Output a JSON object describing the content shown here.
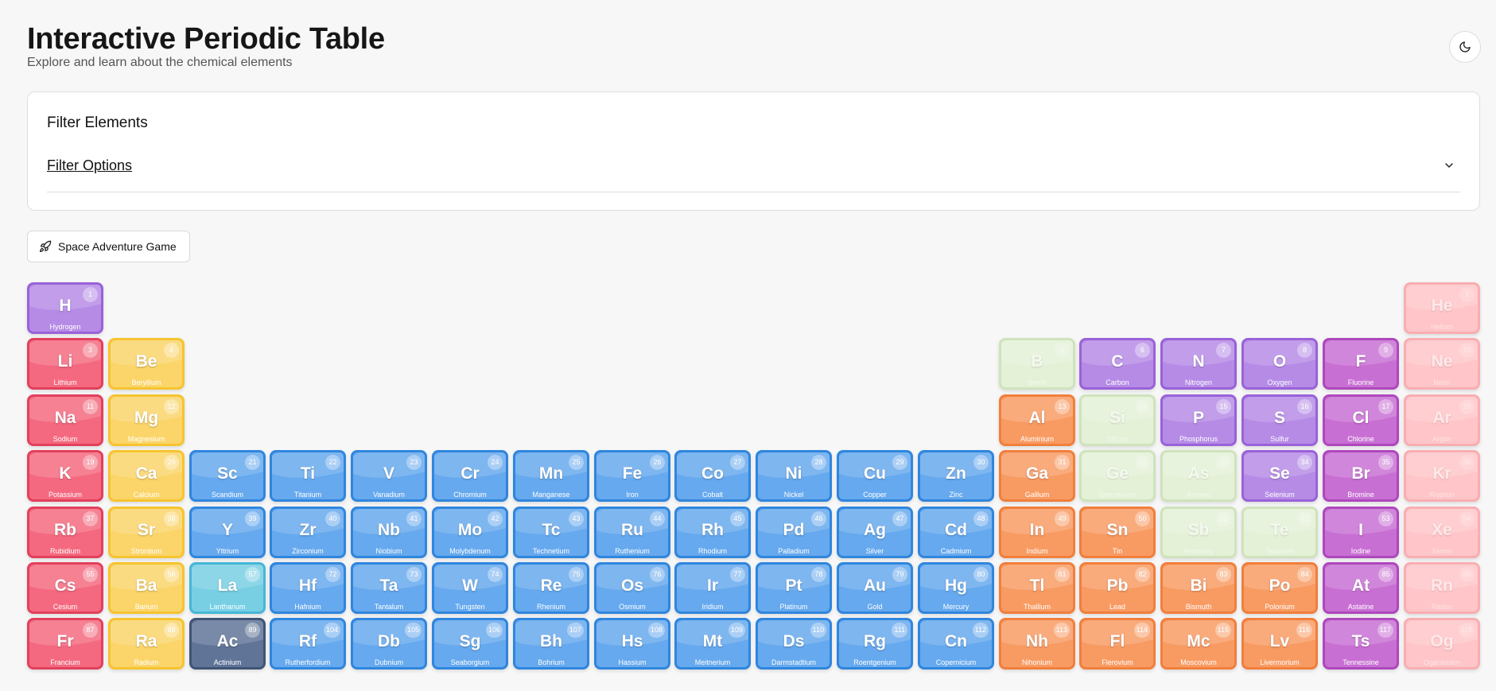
{
  "header": {
    "title": "Interactive Periodic Table",
    "subtitle": "Explore and learn about the chemical elements"
  },
  "theme_toggle": {
    "icon": "moon-icon"
  },
  "filter": {
    "title": "Filter Elements",
    "options_label": "Filter Options",
    "expand_icon": "chevron-down-icon"
  },
  "game_button": {
    "label": "Space Adventure Game",
    "icon": "rocket-icon"
  },
  "categories": {
    "nonmetal": {
      "fill": "#b68be6",
      "border": "#9a62d8"
    },
    "alkali": {
      "fill": "#f4697f",
      "border": "#e2405c"
    },
    "alkaline": {
      "fill": "#fbd56a",
      "border": "#f6c42f"
    },
    "transition": {
      "fill": "#66a9ee",
      "border": "#2f86de"
    },
    "lanthanide": {
      "fill": "#78cfe4",
      "border": "#46b7d6"
    },
    "actinide": {
      "fill": "#5f7497",
      "border": "#3f5476"
    },
    "metalloid": {
      "fill": "#e4f1d7",
      "border": "#cfe3bc"
    },
    "post_transition": {
      "fill": "#f89b63",
      "border": "#f17f3c"
    },
    "halogen": {
      "fill": "#c86fd3",
      "border": "#ae48bc"
    },
    "noble": {
      "fill": "#ffc5c8",
      "border": "#f9aeb2"
    }
  },
  "elements": [
    {
      "n": "1",
      "s": "H",
      "name": "Hydrogen",
      "c": "nonmetal",
      "r": 1,
      "g": 1
    },
    {
      "n": "2",
      "s": "He",
      "name": "Helium",
      "c": "noble",
      "r": 1,
      "g": 18
    },
    {
      "n": "3",
      "s": "Li",
      "name": "Lithium",
      "c": "alkali",
      "r": 2,
      "g": 1
    },
    {
      "n": "4",
      "s": "Be",
      "name": "Beryllium",
      "c": "alkaline",
      "r": 2,
      "g": 2
    },
    {
      "n": "5",
      "s": "B",
      "name": "Boron",
      "c": "metalloid",
      "r": 2,
      "g": 13
    },
    {
      "n": "6",
      "s": "C",
      "name": "Carbon",
      "c": "nonmetal",
      "r": 2,
      "g": 14
    },
    {
      "n": "7",
      "s": "N",
      "name": "Nitrogen",
      "c": "nonmetal",
      "r": 2,
      "g": 15
    },
    {
      "n": "8",
      "s": "O",
      "name": "Oxygen",
      "c": "nonmetal",
      "r": 2,
      "g": 16
    },
    {
      "n": "9",
      "s": "F",
      "name": "Fluorine",
      "c": "halogen",
      "r": 2,
      "g": 17
    },
    {
      "n": "10",
      "s": "Ne",
      "name": "Neon",
      "c": "noble",
      "r": 2,
      "g": 18
    },
    {
      "n": "11",
      "s": "Na",
      "name": "Sodium",
      "c": "alkali",
      "r": 3,
      "g": 1
    },
    {
      "n": "12",
      "s": "Mg",
      "name": "Magnesium",
      "c": "alkaline",
      "r": 3,
      "g": 2
    },
    {
      "n": "13",
      "s": "Al",
      "name": "Aluminium",
      "c": "post_transition",
      "r": 3,
      "g": 13
    },
    {
      "n": "14",
      "s": "Si",
      "name": "Silicon",
      "c": "metalloid",
      "r": 3,
      "g": 14
    },
    {
      "n": "15",
      "s": "P",
      "name": "Phosphorus",
      "c": "nonmetal",
      "r": 3,
      "g": 15
    },
    {
      "n": "16",
      "s": "S",
      "name": "Sulfur",
      "c": "nonmetal",
      "r": 3,
      "g": 16
    },
    {
      "n": "17",
      "s": "Cl",
      "name": "Chlorine",
      "c": "halogen",
      "r": 3,
      "g": 17
    },
    {
      "n": "18",
      "s": "Ar",
      "name": "Argon",
      "c": "noble",
      "r": 3,
      "g": 18
    },
    {
      "n": "19",
      "s": "K",
      "name": "Potassium",
      "c": "alkali",
      "r": 4,
      "g": 1
    },
    {
      "n": "20",
      "s": "Ca",
      "name": "Calcium",
      "c": "alkaline",
      "r": 4,
      "g": 2
    },
    {
      "n": "21",
      "s": "Sc",
      "name": "Scandium",
      "c": "transition",
      "r": 4,
      "g": 3
    },
    {
      "n": "22",
      "s": "Ti",
      "name": "Titanium",
      "c": "transition",
      "r": 4,
      "g": 4
    },
    {
      "n": "23",
      "s": "V",
      "name": "Vanadium",
      "c": "transition",
      "r": 4,
      "g": 5
    },
    {
      "n": "24",
      "s": "Cr",
      "name": "Chromium",
      "c": "transition",
      "r": 4,
      "g": 6
    },
    {
      "n": "25",
      "s": "Mn",
      "name": "Manganese",
      "c": "transition",
      "r": 4,
      "g": 7
    },
    {
      "n": "26",
      "s": "Fe",
      "name": "Iron",
      "c": "transition",
      "r": 4,
      "g": 8
    },
    {
      "n": "27",
      "s": "Co",
      "name": "Cobalt",
      "c": "transition",
      "r": 4,
      "g": 9
    },
    {
      "n": "28",
      "s": "Ni",
      "name": "Nickel",
      "c": "transition",
      "r": 4,
      "g": 10
    },
    {
      "n": "29",
      "s": "Cu",
      "name": "Copper",
      "c": "transition",
      "r": 4,
      "g": 11
    },
    {
      "n": "30",
      "s": "Zn",
      "name": "Zinc",
      "c": "transition",
      "r": 4,
      "g": 12
    },
    {
      "n": "31",
      "s": "Ga",
      "name": "Gallium",
      "c": "post_transition",
      "r": 4,
      "g": 13
    },
    {
      "n": "32",
      "s": "Ge",
      "name": "Germanium",
      "c": "metalloid",
      "r": 4,
      "g": 14
    },
    {
      "n": "33",
      "s": "As",
      "name": "Arsenic",
      "c": "metalloid",
      "r": 4,
      "g": 15
    },
    {
      "n": "34",
      "s": "Se",
      "name": "Selenium",
      "c": "nonmetal",
      "r": 4,
      "g": 16
    },
    {
      "n": "35",
      "s": "Br",
      "name": "Bromine",
      "c": "halogen",
      "r": 4,
      "g": 17
    },
    {
      "n": "36",
      "s": "Kr",
      "name": "Krypton",
      "c": "noble",
      "r": 4,
      "g": 18
    },
    {
      "n": "37",
      "s": "Rb",
      "name": "Rubidium",
      "c": "alkali",
      "r": 5,
      "g": 1
    },
    {
      "n": "38",
      "s": "Sr",
      "name": "Strontium",
      "c": "alkaline",
      "r": 5,
      "g": 2
    },
    {
      "n": "39",
      "s": "Y",
      "name": "Yttrium",
      "c": "transition",
      "r": 5,
      "g": 3
    },
    {
      "n": "40",
      "s": "Zr",
      "name": "Zirconium",
      "c": "transition",
      "r": 5,
      "g": 4
    },
    {
      "n": "41",
      "s": "Nb",
      "name": "Niobium",
      "c": "transition",
      "r": 5,
      "g": 5
    },
    {
      "n": "42",
      "s": "Mo",
      "name": "Molybdenum",
      "c": "transition",
      "r": 5,
      "g": 6
    },
    {
      "n": "43",
      "s": "Tc",
      "name": "Technetium",
      "c": "transition",
      "r": 5,
      "g": 7
    },
    {
      "n": "44",
      "s": "Ru",
      "name": "Ruthenium",
      "c": "transition",
      "r": 5,
      "g": 8
    },
    {
      "n": "45",
      "s": "Rh",
      "name": "Rhodium",
      "c": "transition",
      "r": 5,
      "g": 9
    },
    {
      "n": "46",
      "s": "Pd",
      "name": "Palladium",
      "c": "transition",
      "r": 5,
      "g": 10
    },
    {
      "n": "47",
      "s": "Ag",
      "name": "Silver",
      "c": "transition",
      "r": 5,
      "g": 11
    },
    {
      "n": "48",
      "s": "Cd",
      "name": "Cadmium",
      "c": "transition",
      "r": 5,
      "g": 12
    },
    {
      "n": "49",
      "s": "In",
      "name": "Indium",
      "c": "post_transition",
      "r": 5,
      "g": 13
    },
    {
      "n": "50",
      "s": "Sn",
      "name": "Tin",
      "c": "post_transition",
      "r": 5,
      "g": 14
    },
    {
      "n": "51",
      "s": "Sb",
      "name": "Antimony",
      "c": "metalloid",
      "r": 5,
      "g": 15
    },
    {
      "n": "52",
      "s": "Te",
      "name": "Tellurium",
      "c": "metalloid",
      "r": 5,
      "g": 16
    },
    {
      "n": "53",
      "s": "I",
      "name": "Iodine",
      "c": "halogen",
      "r": 5,
      "g": 17
    },
    {
      "n": "54",
      "s": "Xe",
      "name": "Xenon",
      "c": "noble",
      "r": 5,
      "g": 18
    },
    {
      "n": "55",
      "s": "Cs",
      "name": "Cesium",
      "c": "alkali",
      "r": 6,
      "g": 1
    },
    {
      "n": "56",
      "s": "Ba",
      "name": "Barium",
      "c": "alkaline",
      "r": 6,
      "g": 2
    },
    {
      "n": "57",
      "s": "La",
      "name": "Lanthanum",
      "c": "lanthanide",
      "r": 6,
      "g": 3
    },
    {
      "n": "72",
      "s": "Hf",
      "name": "Hafnium",
      "c": "transition",
      "r": 6,
      "g": 4
    },
    {
      "n": "73",
      "s": "Ta",
      "name": "Tantalum",
      "c": "transition",
      "r": 6,
      "g": 5
    },
    {
      "n": "74",
      "s": "W",
      "name": "Tungsten",
      "c": "transition",
      "r": 6,
      "g": 6
    },
    {
      "n": "75",
      "s": "Re",
      "name": "Rhenium",
      "c": "transition",
      "r": 6,
      "g": 7
    },
    {
      "n": "76",
      "s": "Os",
      "name": "Osmium",
      "c": "transition",
      "r": 6,
      "g": 8
    },
    {
      "n": "77",
      "s": "Ir",
      "name": "Iridium",
      "c": "transition",
      "r": 6,
      "g": 9
    },
    {
      "n": "78",
      "s": "Pt",
      "name": "Platinum",
      "c": "transition",
      "r": 6,
      "g": 10
    },
    {
      "n": "79",
      "s": "Au",
      "name": "Gold",
      "c": "transition",
      "r": 6,
      "g": 11
    },
    {
      "n": "80",
      "s": "Hg",
      "name": "Mercury",
      "c": "transition",
      "r": 6,
      "g": 12
    },
    {
      "n": "81",
      "s": "Tl",
      "name": "Thallium",
      "c": "post_transition",
      "r": 6,
      "g": 13
    },
    {
      "n": "82",
      "s": "Pb",
      "name": "Lead",
      "c": "post_transition",
      "r": 6,
      "g": 14
    },
    {
      "n": "83",
      "s": "Bi",
      "name": "Bismuth",
      "c": "post_transition",
      "r": 6,
      "g": 15
    },
    {
      "n": "84",
      "s": "Po",
      "name": "Polonium",
      "c": "post_transition",
      "r": 6,
      "g": 16
    },
    {
      "n": "85",
      "s": "At",
      "name": "Astatine",
      "c": "halogen",
      "r": 6,
      "g": 17
    },
    {
      "n": "86",
      "s": "Rn",
      "name": "Radon",
      "c": "noble",
      "r": 6,
      "g": 18
    },
    {
      "n": "87",
      "s": "Fr",
      "name": "Francium",
      "c": "alkali",
      "r": 7,
      "g": 1
    },
    {
      "n": "88",
      "s": "Ra",
      "name": "Radium",
      "c": "alkaline",
      "r": 7,
      "g": 2
    },
    {
      "n": "89",
      "s": "Ac",
      "name": "Actinium",
      "c": "actinide",
      "r": 7,
      "g": 3
    },
    {
      "n": "104",
      "s": "Rf",
      "name": "Rutherfordium",
      "c": "transition",
      "r": 7,
      "g": 4
    },
    {
      "n": "105",
      "s": "Db",
      "name": "Dubnium",
      "c": "transition",
      "r": 7,
      "g": 5
    },
    {
      "n": "106",
      "s": "Sg",
      "name": "Seaborgium",
      "c": "transition",
      "r": 7,
      "g": 6
    },
    {
      "n": "107",
      "s": "Bh",
      "name": "Bohrium",
      "c": "transition",
      "r": 7,
      "g": 7
    },
    {
      "n": "108",
      "s": "Hs",
      "name": "Hassium",
      "c": "transition",
      "r": 7,
      "g": 8
    },
    {
      "n": "109",
      "s": "Mt",
      "name": "Meitnerium",
      "c": "transition",
      "r": 7,
      "g": 9
    },
    {
      "n": "110",
      "s": "Ds",
      "name": "Darmstadtium",
      "c": "transition",
      "r": 7,
      "g": 10
    },
    {
      "n": "111",
      "s": "Rg",
      "name": "Roentgenium",
      "c": "transition",
      "r": 7,
      "g": 11
    },
    {
      "n": "112",
      "s": "Cn",
      "name": "Copernicium",
      "c": "transition",
      "r": 7,
      "g": 12
    },
    {
      "n": "113",
      "s": "Nh",
      "name": "Nihonium",
      "c": "post_transition",
      "r": 7,
      "g": 13
    },
    {
      "n": "114",
      "s": "Fl",
      "name": "Flerovium",
      "c": "post_transition",
      "r": 7,
      "g": 14
    },
    {
      "n": "115",
      "s": "Mc",
      "name": "Moscovium",
      "c": "post_transition",
      "r": 7,
      "g": 15
    },
    {
      "n": "116",
      "s": "Lv",
      "name": "Livermorium",
      "c": "post_transition",
      "r": 7,
      "g": 16
    },
    {
      "n": "117",
      "s": "Ts",
      "name": "Tennessine",
      "c": "halogen",
      "r": 7,
      "g": 17
    },
    {
      "n": "118",
      "s": "Og",
      "name": "Oganesson",
      "c": "noble",
      "r": 7,
      "g": 18
    }
  ]
}
